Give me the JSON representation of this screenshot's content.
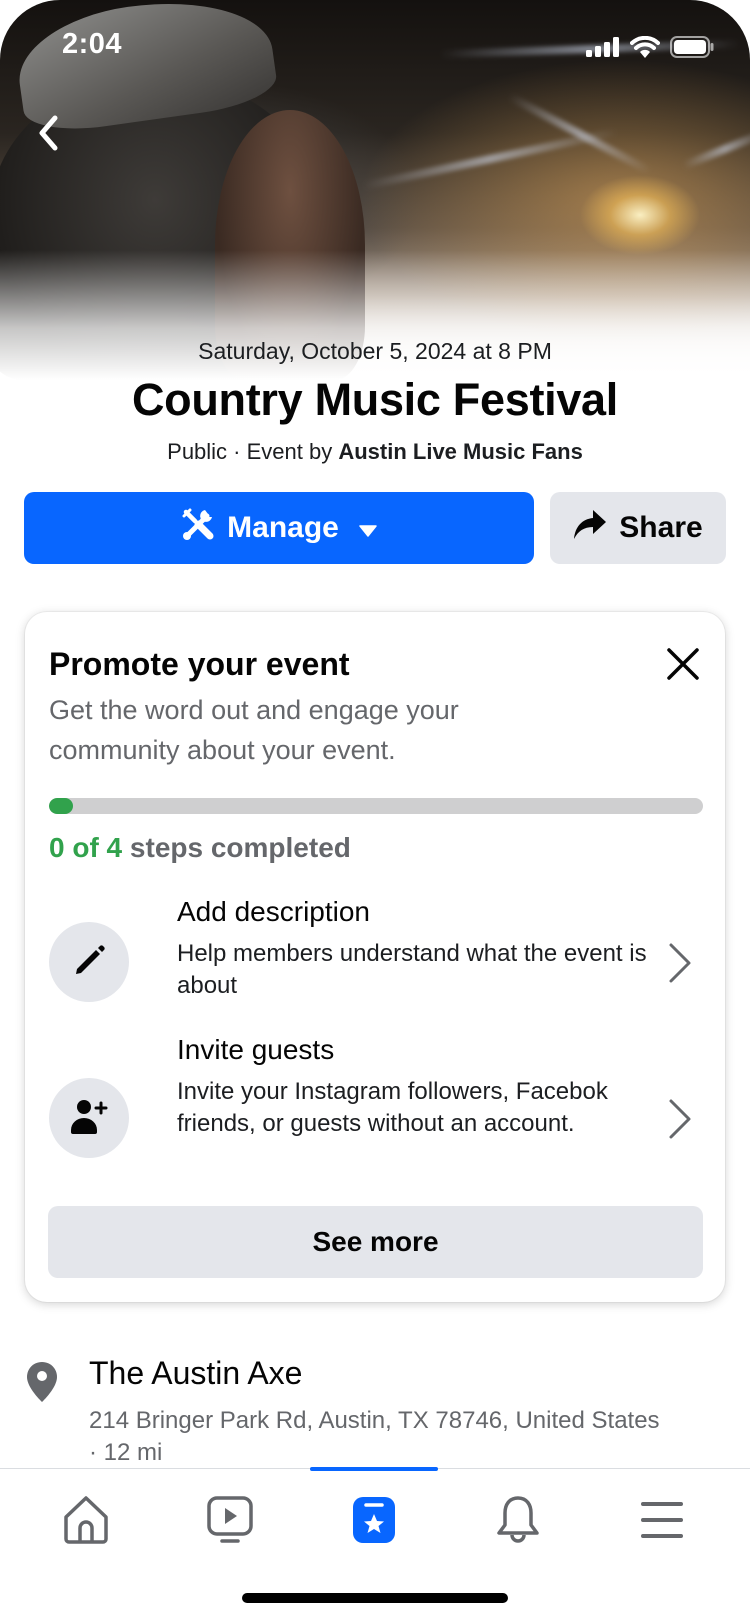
{
  "status_bar": {
    "time": "2:04",
    "icons": [
      "signal-icon",
      "wifi-icon",
      "battery-icon"
    ]
  },
  "nav": {
    "back_icon": "chevron-left-icon"
  },
  "event": {
    "date": "Saturday, October 5, 2024 at 8 PM",
    "title": "Country Music Festival",
    "privacy": "Public",
    "separator": " · ",
    "event_by_prefix": "Event by ",
    "host": "Austin Live Music Fans"
  },
  "actions": {
    "manage_label": "Manage",
    "manage_icon": "tools-icon",
    "share_label": "Share",
    "share_icon": "share-arrow-icon"
  },
  "promo": {
    "title": "Promote your event",
    "subtitle": "Get the word out and engage your community about your event.",
    "progress": {
      "completed": 0,
      "total": 4,
      "count_text": "0 of 4",
      "suffix_text": " steps completed"
    },
    "steps": [
      {
        "title": "Add description",
        "description": "Help members understand what the event is about",
        "icon": "pencil-icon"
      },
      {
        "title": "Invite guests",
        "description": "Invite your Instagram followers, Facebok friends, or guests without an account.",
        "icon": "add-person-icon"
      }
    ],
    "see_more_label": "See more"
  },
  "location": {
    "name": "The Austin Axe",
    "address": "214 Bringer Park Rd, Austin, TX 78746, United States · 12 mi"
  },
  "tab_bar": {
    "tabs": [
      {
        "name": "home",
        "icon": "home-icon",
        "active": false
      },
      {
        "name": "video",
        "icon": "video-icon",
        "active": false
      },
      {
        "name": "events",
        "icon": "events-icon",
        "active": true
      },
      {
        "name": "notifications",
        "icon": "bell-icon",
        "active": false
      },
      {
        "name": "menu",
        "icon": "menu-icon",
        "active": false
      }
    ]
  },
  "colors": {
    "primary_blue": "#0866ff",
    "progress_green": "#31a24c",
    "secondary_text": "#65676b",
    "button_gray": "#e4e6eb"
  }
}
